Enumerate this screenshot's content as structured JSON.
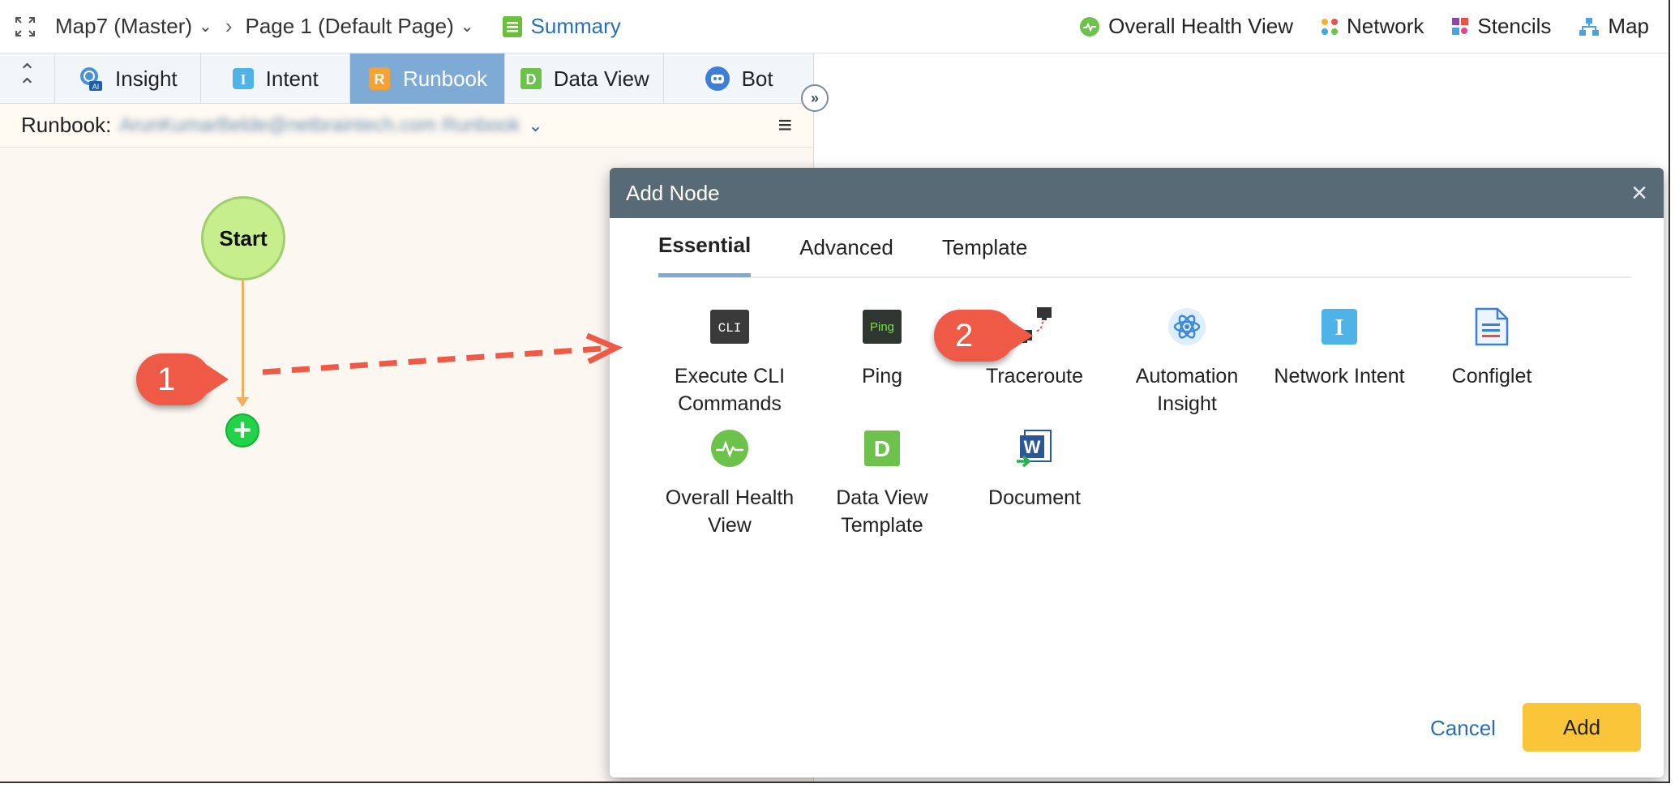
{
  "topbar": {
    "map_name": "Map7 (Master)",
    "page_name": "Page 1  (Default Page)",
    "summary": "Summary",
    "right_items": {
      "health": "Overall Health View",
      "network": "Network",
      "stencils": "Stencils",
      "map": "Map"
    }
  },
  "panel": {
    "tabs": {
      "insight": "Insight",
      "intent": "Intent",
      "runbook": "Runbook",
      "dataview": "Data View",
      "bot": "Bot"
    },
    "runbook_label": "Runbook:",
    "runbook_name": "ArunKumarBelde@netbraintech.com Runbook",
    "start_node": "Start"
  },
  "callouts": {
    "one": "1",
    "two": "2"
  },
  "modal": {
    "title": "Add Node",
    "tabs": {
      "essential": "Essential",
      "advanced": "Advanced",
      "template": "Template"
    },
    "nodes": {
      "cli": "Execute CLI Commands",
      "ping": "Ping",
      "traceroute": "Traceroute",
      "automation": "Automation Insight",
      "intent": "Network Intent",
      "configlet": "Configlet",
      "health": "Overall Health View",
      "dataview": "Data View Template",
      "document": "Document"
    },
    "icon_text": {
      "cli": "CLI",
      "ping": "Ping",
      "intent": "I",
      "dataview": "D",
      "document": "W"
    },
    "cancel": "Cancel",
    "add": "Add"
  },
  "colors": {
    "accent_blue": "#2a6fb3",
    "active_tab": "#7eabd6",
    "modal_header": "#586a75",
    "add_button": "#fbc53a",
    "callout": "#ef5a47",
    "start_node": "#c6ee8c",
    "add_node": "#22d34a"
  }
}
